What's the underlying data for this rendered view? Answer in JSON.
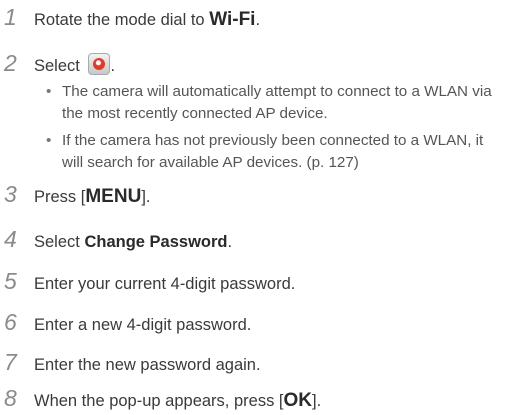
{
  "steps": [
    {
      "number": "1",
      "text_before": "Rotate the mode dial to ",
      "text_strong": "Wi-Fi",
      "text_after": "."
    },
    {
      "number": "2",
      "text_before": "Select ",
      "icon": "wifi-mode-icon",
      "text_after": "."
    },
    {
      "number": "3",
      "text_before": "Press [",
      "text_strong": "MENU",
      "text_after": "]."
    },
    {
      "number": "4",
      "text_before": "Select ",
      "text_strong": "Change Password",
      "text_after": "."
    },
    {
      "number": "5",
      "text": "Enter your current 4-digit password."
    },
    {
      "number": "6",
      "text": "Enter a new 4-digit password."
    },
    {
      "number": "7",
      "text": "Enter the new password again."
    },
    {
      "number": "8",
      "text_before": "When the pop-up appears, press [",
      "text_strong": "OK",
      "text_after": "]."
    }
  ],
  "step2_bullets": [
    {
      "marker": "•",
      "text": "The camera will automatically attempt to connect to a WLAN via the most recently connected AP device."
    },
    {
      "marker": "•",
      "text": "If the camera has not previously been connected to a WLAN, it will search for available AP devices. (p. 127)"
    }
  ]
}
